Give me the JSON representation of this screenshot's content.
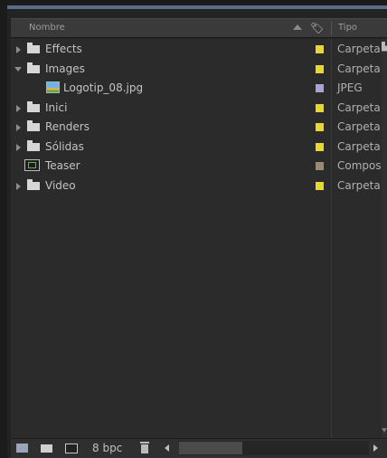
{
  "header": {
    "name_column": "Nombre",
    "type_column": "Tipo",
    "sort_icon": "sort-ascending-icon",
    "label_icon": "label-tag-icon"
  },
  "items": [
    {
      "name": "Effects",
      "type": "Carpeta",
      "kind": "folder",
      "expanded": false,
      "label_color": "#e8d632"
    },
    {
      "name": "Images",
      "type": "Carpeta",
      "kind": "folder",
      "expanded": true,
      "label_color": "#e8d632"
    },
    {
      "name": "Logotip_08.jpg",
      "type": "JPEG",
      "kind": "image",
      "label_color": "#a9a2d4"
    },
    {
      "name": "Inici",
      "type": "Carpeta",
      "kind": "folder",
      "expanded": false,
      "label_color": "#e8d632"
    },
    {
      "name": "Renders",
      "type": "Carpeta",
      "kind": "folder",
      "expanded": false,
      "label_color": "#e8d632"
    },
    {
      "name": "Sólidas",
      "type": "Carpeta",
      "kind": "folder",
      "expanded": false,
      "label_color": "#e8d632"
    },
    {
      "name": "Teaser",
      "type": "Compos",
      "kind": "composition",
      "label_color": "#9d8a73"
    },
    {
      "name": "Video",
      "type": "Carpeta",
      "kind": "folder",
      "expanded": false,
      "label_color": "#e8d632"
    }
  ],
  "bottom_bar": {
    "bit_depth": "8 bpc"
  }
}
